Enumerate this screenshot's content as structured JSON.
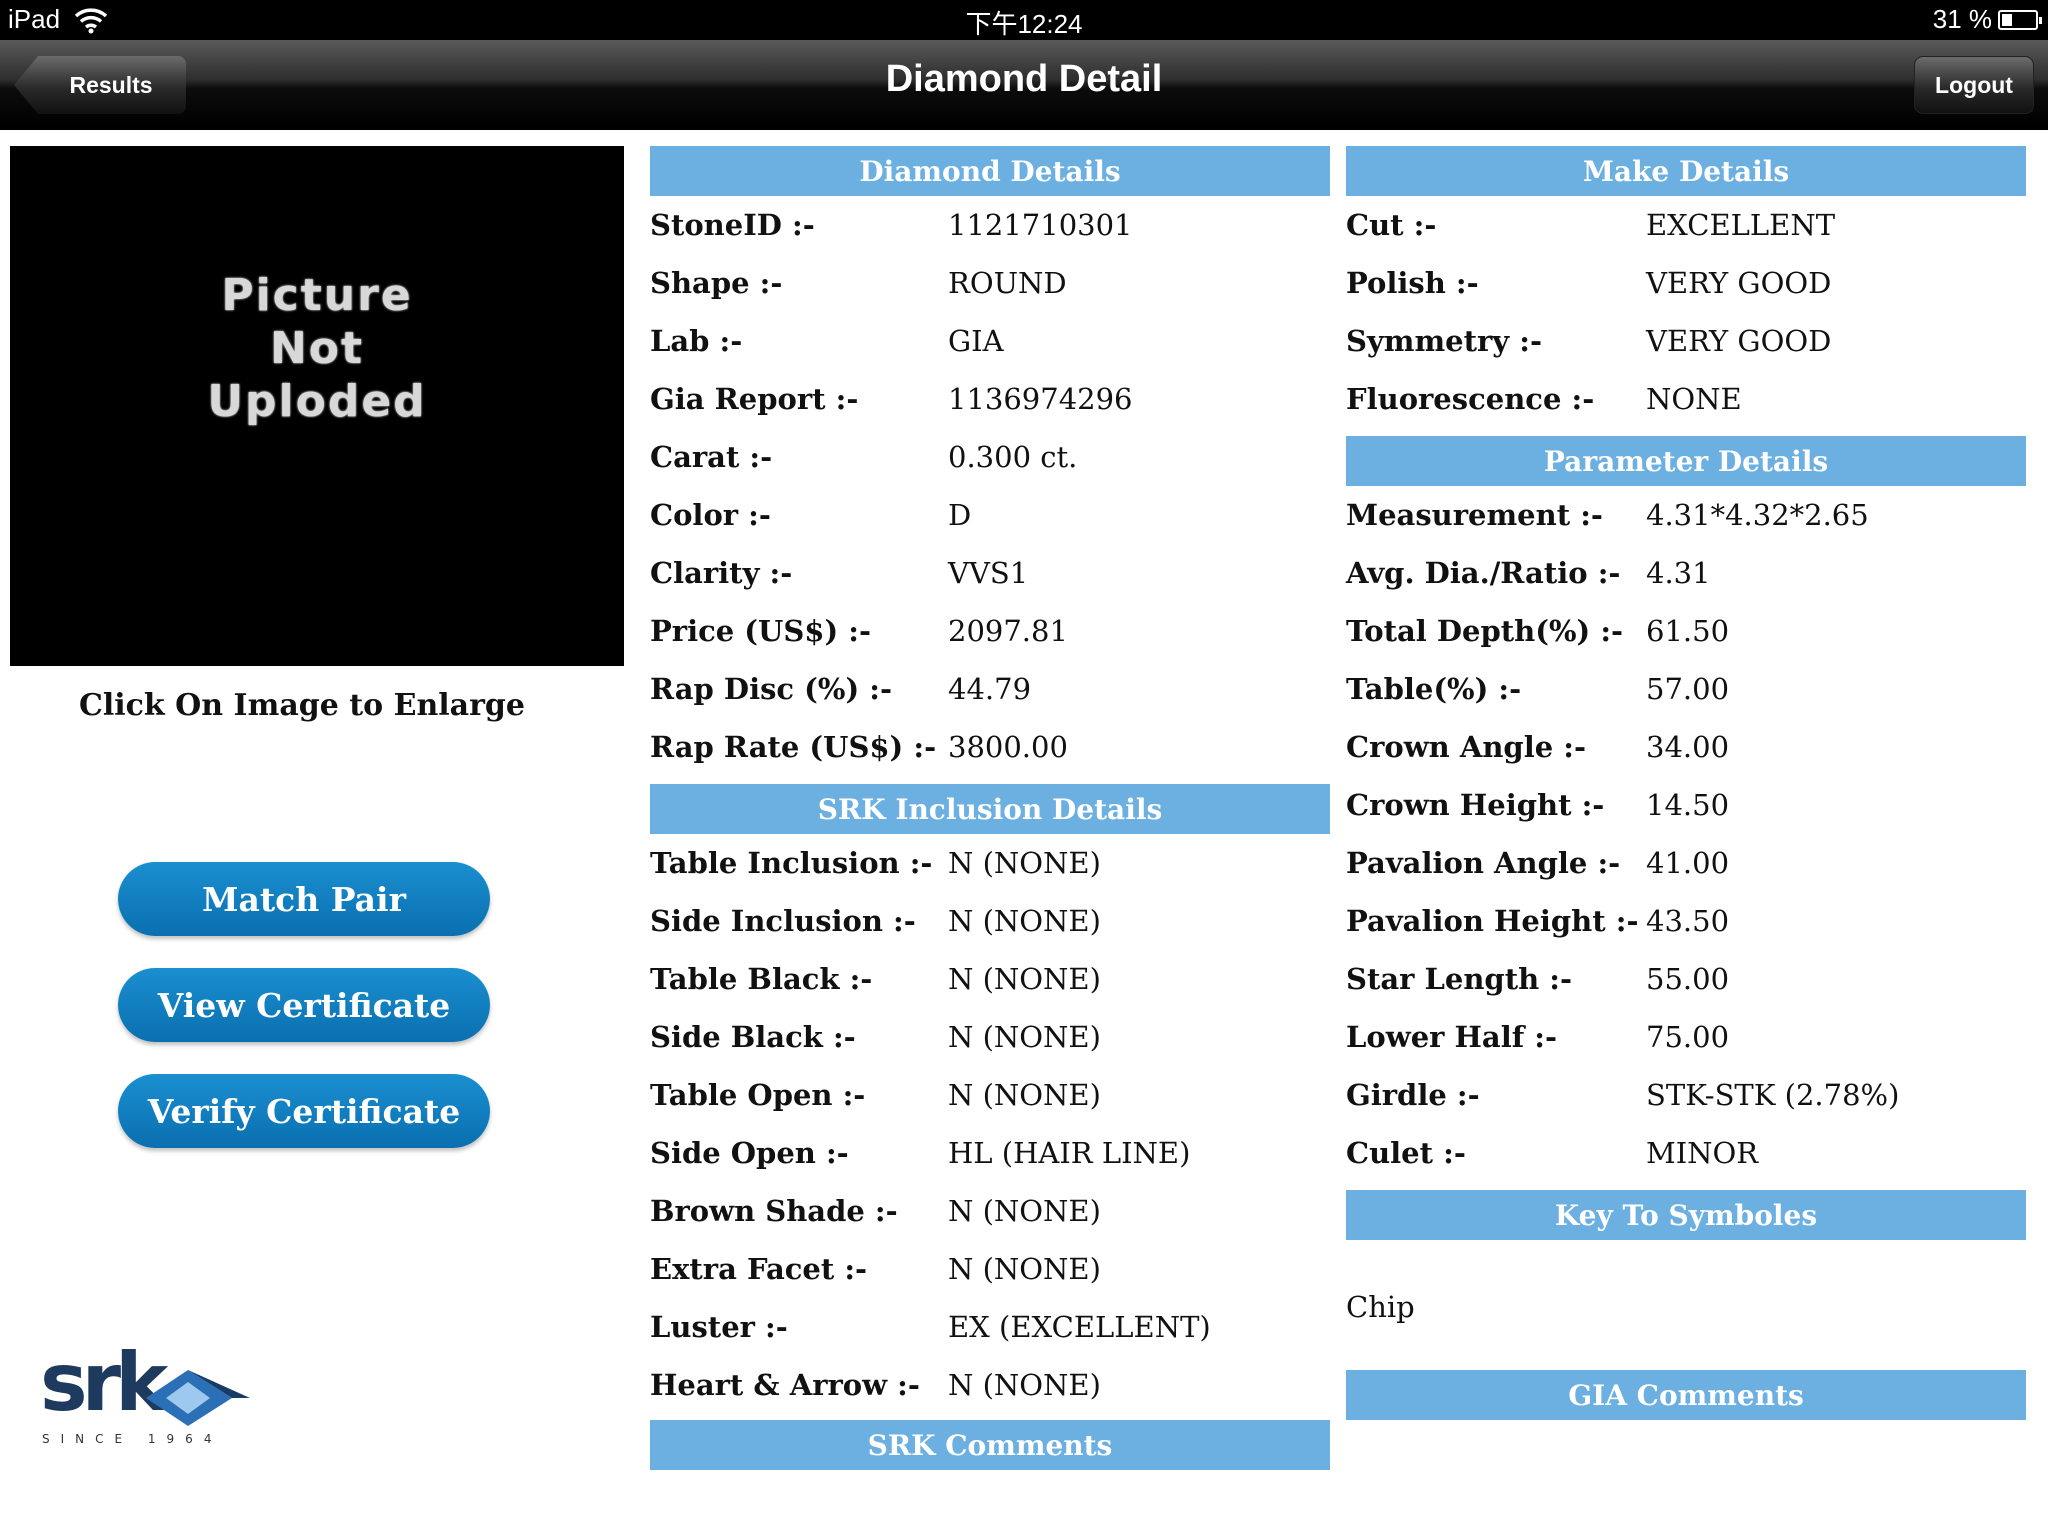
{
  "status_bar": {
    "device": "iPad",
    "time": "下午12:24",
    "battery": "31 %",
    "battery_level": 0.31,
    "wifi_icon": "wifi-icon",
    "battery_icon": "battery-icon"
  },
  "nav": {
    "title": "Diamond Detail",
    "back_label": "Results",
    "logout_label": "Logout"
  },
  "left": {
    "photo_text": "Picture Not Uploded",
    "enlarge_hint": "Click On Image to Enlarge",
    "buttons": {
      "match_pair": "Match Pair",
      "view_certificate": "View Certificate",
      "verify_certificate": "Verify Certificate"
    },
    "logo": {
      "word": "srk",
      "since": "SINCE 1964"
    }
  },
  "diamond_details": {
    "title": "Diamond Details",
    "rows": [
      {
        "label": "StoneID :-",
        "value": "1121710301"
      },
      {
        "label": "Shape :-",
        "value": "ROUND"
      },
      {
        "label": "Lab :-",
        "value": "GIA"
      },
      {
        "label": "Gia Report :-",
        "value": "1136974296"
      },
      {
        "label": "Carat :-",
        "value": "0.300 ct."
      },
      {
        "label": "Color :-",
        "value": "D"
      },
      {
        "label": "Clarity :-",
        "value": "VVS1"
      },
      {
        "label": "Price (US$) :-",
        "value": "2097.81"
      },
      {
        "label": "Rap Disc (%) :-",
        "value": "44.79"
      },
      {
        "label": "Rap Rate (US$) :-",
        "value": "3800.00"
      }
    ]
  },
  "inclusion_details": {
    "title": "SRK Inclusion Details",
    "rows": [
      {
        "label": "Table Inclusion :-",
        "value": "N (NONE)"
      },
      {
        "label": "Side Inclusion :-",
        "value": "N (NONE)"
      },
      {
        "label": "Table Black :-",
        "value": "N (NONE)"
      },
      {
        "label": "Side Black :-",
        "value": "N (NONE)"
      },
      {
        "label": "Table Open :-",
        "value": "N (NONE)"
      },
      {
        "label": "Side Open :-",
        "value": "HL (HAIR LINE)"
      },
      {
        "label": "Brown Shade :-",
        "value": "N (NONE)"
      },
      {
        "label": "Extra Facet :-",
        "value": "N (NONE)"
      },
      {
        "label": "Luster :-",
        "value": "EX (EXCELLENT)"
      },
      {
        "label": "Heart & Arrow :-",
        "value": "N (NONE)"
      }
    ]
  },
  "srk_comments": {
    "title": "SRK Comments"
  },
  "make_details": {
    "title": "Make Details",
    "rows": [
      {
        "label": "Cut :-",
        "value": "EXCELLENT"
      },
      {
        "label": "Polish :-",
        "value": "VERY GOOD"
      },
      {
        "label": "Symmetry :-",
        "value": "VERY GOOD"
      },
      {
        "label": "Fluorescence :-",
        "value": "NONE"
      }
    ]
  },
  "parameter_details": {
    "title": "Parameter Details",
    "rows": [
      {
        "label": "Measurement :-",
        "value": "4.31*4.32*2.65"
      },
      {
        "label": "Avg. Dia./Ratio :-",
        "value": "4.31"
      },
      {
        "label": "Total Depth(%) :-",
        "value": "61.50"
      },
      {
        "label": "Table(%) :-",
        "value": "57.00"
      },
      {
        "label": "Crown Angle :-",
        "value": "34.00"
      },
      {
        "label": "Crown Height :-",
        "value": "14.50"
      },
      {
        "label": "Pavalion Angle :-",
        "value": "41.00"
      },
      {
        "label": "Pavalion Height :-",
        "value": "43.50"
      },
      {
        "label": "Star Length :-",
        "value": "55.00"
      },
      {
        "label": "Lower Half :-",
        "value": "75.00"
      },
      {
        "label": "Girdle  :-",
        "value": "STK-STK (2.78%)"
      },
      {
        "label": "Culet :-",
        "value": "MINOR"
      }
    ]
  },
  "key_to_symbols": {
    "title": "Key To Symboles",
    "items": [
      "Chip"
    ]
  },
  "gia_comments": {
    "title": "GIA Comments"
  }
}
